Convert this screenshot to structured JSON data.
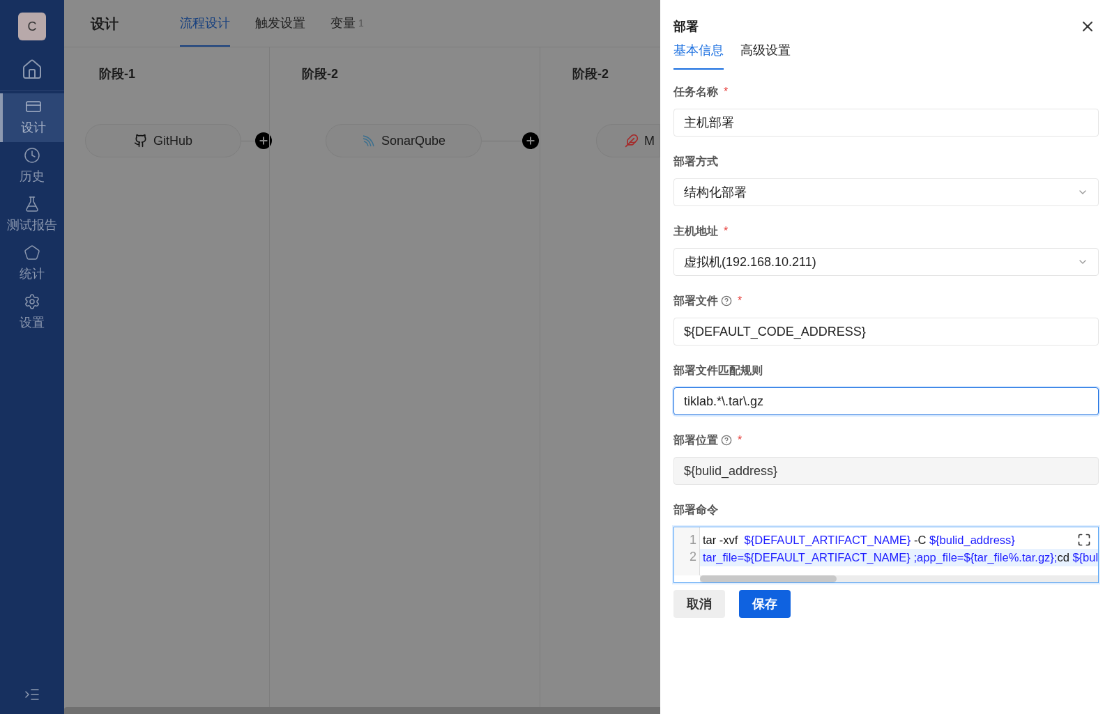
{
  "sidebar": {
    "avatar": "C",
    "items": [
      {
        "selected": false
      },
      {
        "label": "设计",
        "selected": true
      },
      {
        "label": "历史",
        "selected": false
      },
      {
        "label": "测试报告",
        "selected": false
      },
      {
        "label": "统计",
        "selected": false
      },
      {
        "label": "设置",
        "selected": false
      }
    ]
  },
  "header": {
    "title": "设计",
    "tabs": [
      {
        "label": "流程设计",
        "selected": true
      },
      {
        "label": "触发设置",
        "selected": false
      },
      {
        "label": "变量",
        "count": "1",
        "selected": false
      }
    ]
  },
  "stages": [
    {
      "title": "阶段-1",
      "task": {
        "label": "GitHub"
      }
    },
    {
      "title": "阶段-2",
      "task": {
        "label": "SonarQube"
      }
    },
    {
      "title": "阶段-2",
      "task": {
        "label": "M"
      }
    }
  ],
  "drawer": {
    "title": "部署",
    "tabs": [
      {
        "label": "基本信息",
        "selected": true
      },
      {
        "label": "高级设置",
        "selected": false
      }
    ],
    "fields": [
      {
        "label": "任务名称",
        "kind": "input",
        "required_mark": "*",
        "help": false,
        "value": "主机部署",
        "focused": false,
        "disabled": false
      },
      {
        "label": "部署方式",
        "kind": "select",
        "help": false,
        "value": "结构化部署",
        "focused": false,
        "disabled": false
      },
      {
        "label": "主机地址",
        "kind": "select",
        "required_mark": "*",
        "help": false,
        "value": "虚拟机(192.168.10.211)",
        "focused": false,
        "disabled": false
      },
      {
        "label": "部署文件",
        "kind": "input",
        "required_mark": "*",
        "help": true,
        "value": "${DEFAULT_CODE_ADDRESS}",
        "focused": false,
        "disabled": false
      },
      {
        "label": "部署文件匹配规则",
        "kind": "input",
        "help": false,
        "value": "tiklab.*\\.tar\\.gz",
        "focused": true,
        "disabled": false
      },
      {
        "label": "部署位置",
        "kind": "input",
        "required_mark": "*",
        "help": true,
        "value": "${bulid_address}",
        "focused": false,
        "disabled": true
      }
    ],
    "command": {
      "label": "部署命令",
      "lines": [
        {
          "number": "1",
          "active": false,
          "tokens": [
            {
              "kind": "plain",
              "text": "tar -xvf  "
            },
            {
              "kind": "var",
              "text": "${DEFAULT_ARTIFACT_NAME}"
            },
            {
              "kind": "plain",
              "text": " -C "
            },
            {
              "kind": "var",
              "text": "${bulid_address}"
            }
          ]
        },
        {
          "number": "2",
          "active": true,
          "tokens": [
            {
              "kind": "var",
              "text": "tar_file=${DEFAULT_ARTIFACT_NAME} ;app_file=${tar_file%.tar.gz};"
            },
            {
              "kind": "plain",
              "text": "cd "
            },
            {
              "kind": "var",
              "text": "${bul"
            }
          ]
        }
      ]
    },
    "buttons": [
      {
        "label": "取消",
        "kind": "secondary"
      },
      {
        "label": "保存",
        "kind": "primary"
      }
    ]
  }
}
